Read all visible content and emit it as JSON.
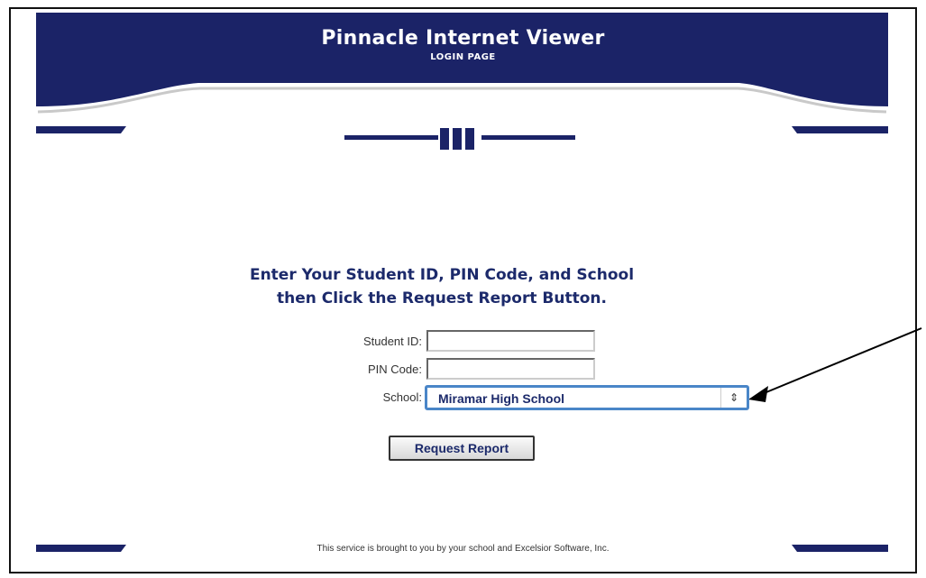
{
  "header": {
    "title": "Pinnacle Internet Viewer",
    "subtitle": "LOGIN PAGE"
  },
  "instructions": {
    "line1": "Enter Your Student ID, PIN Code, and School",
    "line2": "then Click the Request Report Button."
  },
  "form": {
    "student_id_label": "Student ID:",
    "pin_code_label": "PIN Code:",
    "school_label": "School:",
    "school_value": "Miramar High School",
    "submit_label": "Request Report"
  },
  "footer": {
    "text": "This service is brought to you by your school and Excelsior Software, Inc."
  },
  "colors": {
    "navy": "#1b2367",
    "select_border": "#4a86c8"
  }
}
